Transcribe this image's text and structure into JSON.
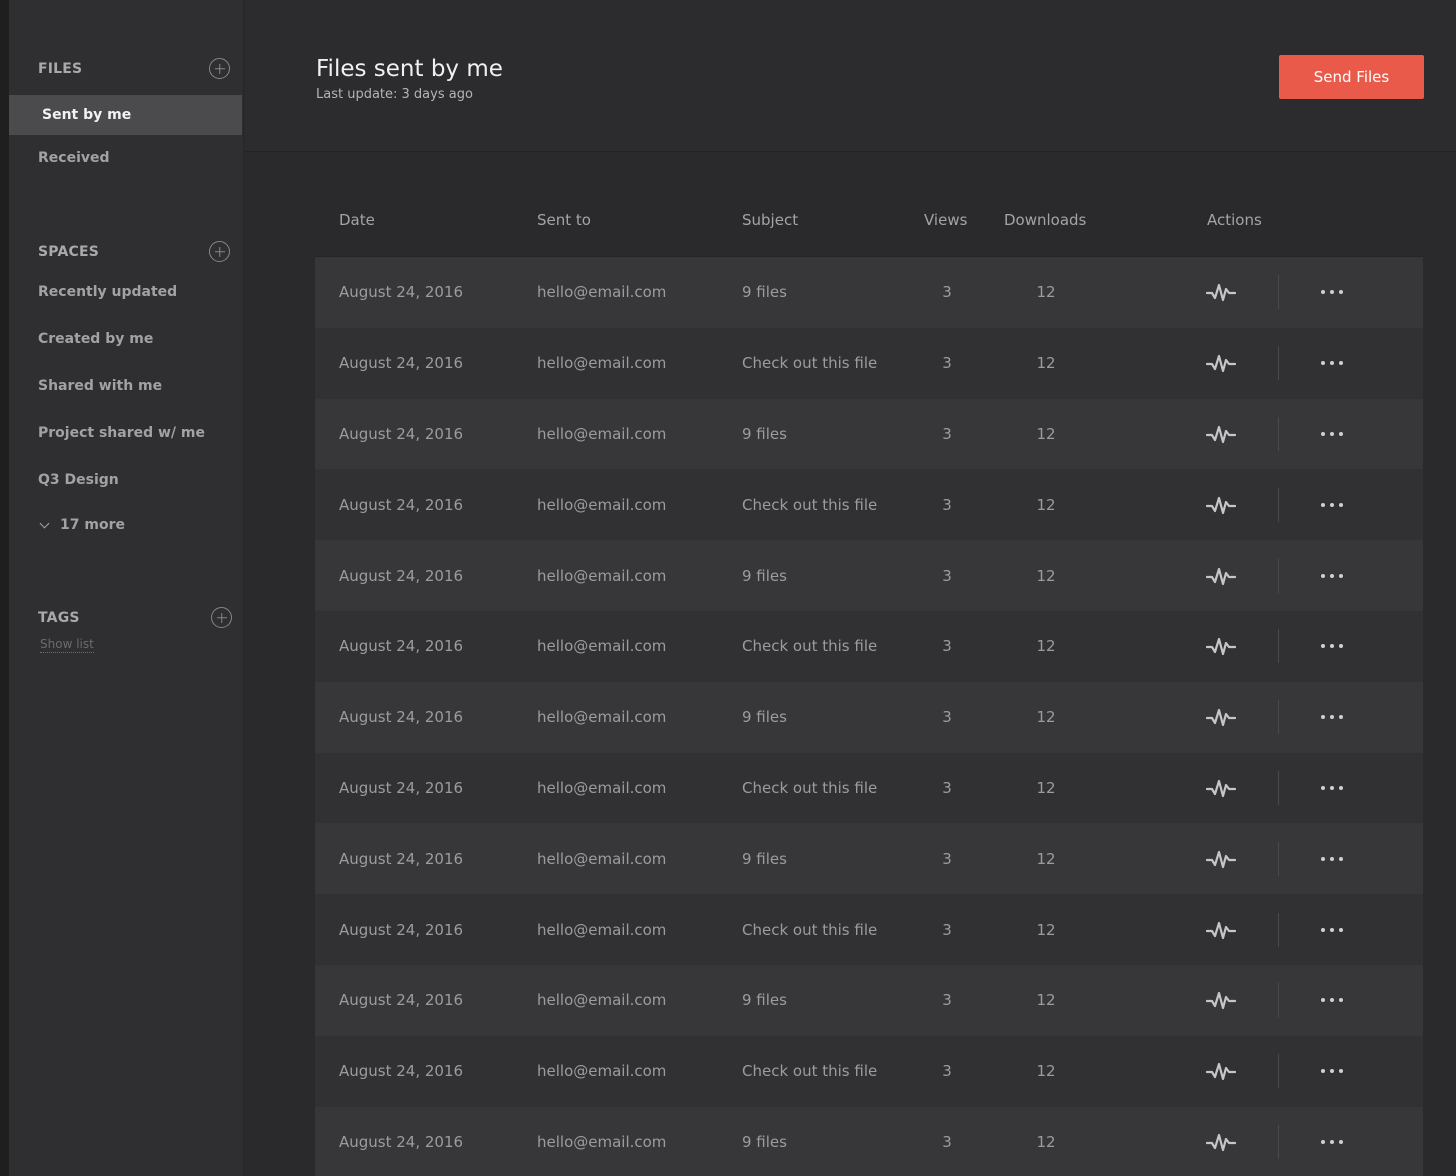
{
  "sidebar": {
    "files": {
      "title": "FILES",
      "items": [
        {
          "label": "Sent by me",
          "active": true
        },
        {
          "label": "Received",
          "active": false
        }
      ]
    },
    "spaces": {
      "title": "SPACES",
      "items": [
        {
          "label": "Recently updated"
        },
        {
          "label": "Created by me"
        },
        {
          "label": "Shared with me"
        },
        {
          "label": "Project shared w/ me"
        },
        {
          "label": "Q3 Design"
        }
      ],
      "more_label": "17 more"
    },
    "tags": {
      "title": "TAGS",
      "show_list_label": "Show list"
    }
  },
  "header": {
    "title": "Files sent by me",
    "subtitle": "Last update: 3 days ago",
    "send_button_label": "Send Files"
  },
  "table": {
    "columns": {
      "date": "Date",
      "sent_to": "Sent to",
      "subject": "Subject",
      "views": "Views",
      "downloads": "Downloads",
      "actions": "Actions"
    },
    "rows": [
      {
        "date": "August 24, 2016",
        "sent_to": "hello@email.com",
        "subject": "9 files",
        "views": "3",
        "downloads": "12"
      },
      {
        "date": "August 24, 2016",
        "sent_to": "hello@email.com",
        "subject": "Check out this file",
        "views": "3",
        "downloads": "12"
      },
      {
        "date": "August 24, 2016",
        "sent_to": "hello@email.com",
        "subject": "9 files",
        "views": "3",
        "downloads": "12"
      },
      {
        "date": "August 24, 2016",
        "sent_to": "hello@email.com",
        "subject": "Check out this file",
        "views": "3",
        "downloads": "12"
      },
      {
        "date": "August 24, 2016",
        "sent_to": "hello@email.com",
        "subject": "9 files",
        "views": "3",
        "downloads": "12"
      },
      {
        "date": "August 24, 2016",
        "sent_to": "hello@email.com",
        "subject": "Check out this file",
        "views": "3",
        "downloads": "12"
      },
      {
        "date": "August 24, 2016",
        "sent_to": "hello@email.com",
        "subject": "9 files",
        "views": "3",
        "downloads": "12"
      },
      {
        "date": "August 24, 2016",
        "sent_to": "hello@email.com",
        "subject": "Check out this file",
        "views": "3",
        "downloads": "12"
      },
      {
        "date": "August 24, 2016",
        "sent_to": "hello@email.com",
        "subject": "9 files",
        "views": "3",
        "downloads": "12"
      },
      {
        "date": "August 24, 2016",
        "sent_to": "hello@email.com",
        "subject": "Check out this file",
        "views": "3",
        "downloads": "12"
      },
      {
        "date": "August 24, 2016",
        "sent_to": "hello@email.com",
        "subject": "9 files",
        "views": "3",
        "downloads": "12"
      },
      {
        "date": "August 24, 2016",
        "sent_to": "hello@email.com",
        "subject": "Check out this file",
        "views": "3",
        "downloads": "12"
      },
      {
        "date": "August 24, 2016",
        "sent_to": "hello@email.com",
        "subject": "9 files",
        "views": "3",
        "downloads": "12"
      }
    ],
    "row_action_icons": [
      "activity-icon",
      "more-options-icon"
    ]
  },
  "colors": {
    "accent": "#ea5a4a",
    "sidebar_bg": "#2f2f31",
    "active_item_bg": "#4b4b4e",
    "main_bg": "#2a2a2c"
  }
}
